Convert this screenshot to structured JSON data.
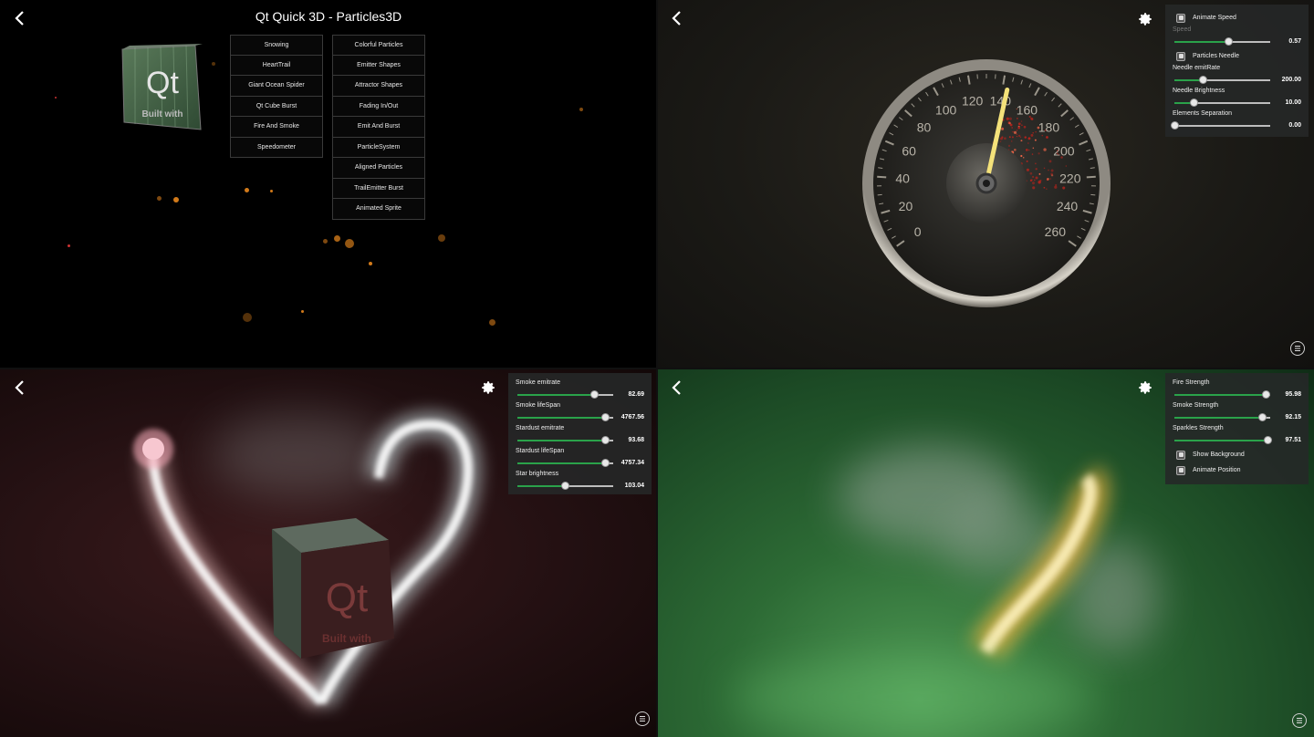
{
  "overview": {
    "title": "Qt Quick 3D - Particles3D",
    "cube_logo": "Qt",
    "cube_caption": "Built with",
    "left_buttons": [
      "Snowing",
      "HeartTrail",
      "Giant Ocean Spider",
      "Qt Cube Burst",
      "Fire And Smoke",
      "Speedometer"
    ],
    "right_buttons": [
      "Colorful Particles",
      "Emitter Shapes",
      "Attractor Shapes",
      "Fading In/Out",
      "Emit And Burst",
      "ParticleSystem",
      "Aligned Particles",
      "TrailEmitter Burst",
      "Animated Sprite"
    ]
  },
  "speedometer": {
    "gauge_labels": [
      "0",
      "20",
      "40",
      "60",
      "80",
      "100",
      "120",
      "140",
      "160",
      "180",
      "200",
      "220",
      "240",
      "260"
    ],
    "needle_value": 143,
    "panel": {
      "animate_speed_label": "Animate Speed",
      "speed": {
        "label": "Speed",
        "value": "0.57",
        "fraction": 0.57
      },
      "particles_needle_label": "Particles Needle",
      "needle_emitrate": {
        "label": "Needle emitRate",
        "value": "200.00",
        "fraction": 0.3
      },
      "needle_brightness": {
        "label": "Needle Brightness",
        "value": "10.00",
        "fraction": 0.2
      },
      "elements_separation": {
        "label": "Elements Separation",
        "value": "0.00",
        "fraction": 0.0
      }
    }
  },
  "heart_trail": {
    "cube_logo": "Qt",
    "cube_caption": "Built with",
    "panel": {
      "sliders": [
        {
          "label": "Smoke emitrate",
          "value": "82.69",
          "fraction": 0.8
        },
        {
          "label": "Smoke lifeSpan",
          "value": "4767.56",
          "fraction": 0.92
        },
        {
          "label": "Stardust emitrate",
          "value": "93.68",
          "fraction": 0.92
        },
        {
          "label": "Stardust lifeSpan",
          "value": "4757.34",
          "fraction": 0.92
        },
        {
          "label": "Star brightness",
          "value": "103.04",
          "fraction": 0.5
        }
      ]
    }
  },
  "fire_smoke": {
    "panel": {
      "sliders": [
        {
          "label": "Fire Strength",
          "value": "95.98",
          "fraction": 0.96
        },
        {
          "label": "Smoke Strength",
          "value": "92.15",
          "fraction": 0.92
        },
        {
          "label": "Sparkles Strength",
          "value": "97.51",
          "fraction": 0.975
        }
      ],
      "show_background_label": "Show Background",
      "animate_position_label": "Animate Position"
    }
  },
  "colors": {
    "accent_green": "#2aa24a",
    "particle_orange": "#d27a1a",
    "needle_yellow": "#f4e27a"
  }
}
